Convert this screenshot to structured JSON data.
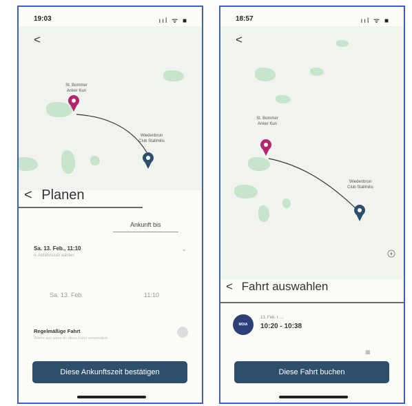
{
  "left": {
    "time": "19:03",
    "system": "ııl ᯤ ■",
    "back": "<",
    "pin_a_label": "St. Bommer\nAnker Kun",
    "pin_b_label": "Wiedenbrun\nClub Stallmilis",
    "sheet_back": "<",
    "title": "Planen",
    "tab_left": "",
    "tab_right": "Ankunft bis",
    "date_row": "Sa. 13. Feb., 11:10",
    "date_sub": "n. Abfahrtszeit wählen",
    "picker_day": "Sa. 13. Feb.",
    "picker_time": "11:10",
    "toggle_label": "Regelmäßige Fahrt",
    "toggle_sub": "Wähle aus wann du diese Fahrt verwendest",
    "button": "Diese Ankunftszeit bestätigen"
  },
  "right": {
    "time": "18:57",
    "system": "ııl ᯤ ■",
    "back": "<",
    "pin_a_label": "St. Bommer\nAnker Kun",
    "pin_b_label": "Wiedenbrun\nClub Stallmilis",
    "map_small": "",
    "sheet_back": "<",
    "title": "Fahrt auswahlen",
    "logo_text": "MOIA",
    "ride_date": "13. Feb. r. ...",
    "ride_time": "10:20 - 10:38",
    "seats": "▦",
    "button": "Diese Fahrt buchen"
  },
  "colors": {
    "button": "#2e4f6c",
    "pin_pink": "#b5256c",
    "pin_blue": "#2e4f6c",
    "frame": "#3c5fc7"
  }
}
